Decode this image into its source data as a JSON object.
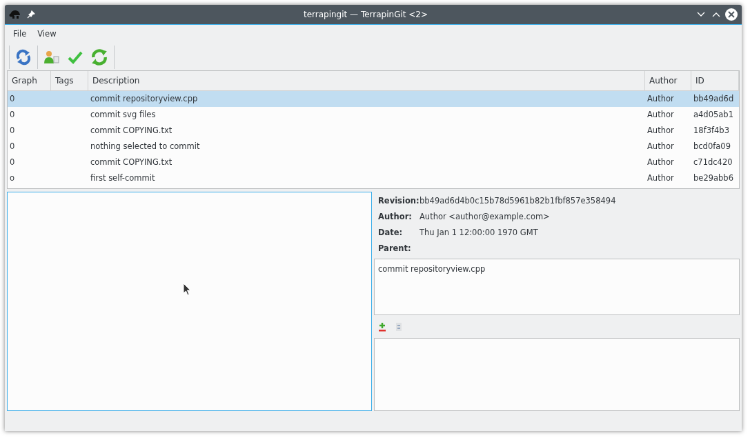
{
  "window": {
    "title": "terrapingit — TerrapinGit <2>"
  },
  "menu": [
    "File",
    "View"
  ],
  "table": {
    "columns": [
      "Graph",
      "Tags",
      "Description",
      "Author",
      "ID"
    ],
    "rows": [
      {
        "graph": "0",
        "tags": "",
        "description": "commit repositoryview.cpp",
        "author": "Author",
        "id": "bb49ad6d",
        "selected": true
      },
      {
        "graph": "0",
        "description": "commit svg files",
        "author": "Author",
        "id": "a4d05ab1",
        "selected": false
      },
      {
        "graph": "0",
        "description": "commit COPYING.txt",
        "author": "Author",
        "id": "18f3f4b3",
        "selected": false
      },
      {
        "graph": "0",
        "description": "nothing selected to commit",
        "author": "Author",
        "id": "bcd0fa09",
        "selected": false
      },
      {
        "graph": "0",
        "description": "commit COPYING.txt",
        "author": "Author",
        "id": "c71dc420",
        "selected": false
      },
      {
        "graph": "o",
        "description": "first self-commit",
        "author": "Author",
        "id": "be29abb6",
        "selected": false
      }
    ]
  },
  "details": [
    {
      "label": "Revision:",
      "value": "bb49ad6d4b0c15b78d5961b82b1fbf857e358494"
    },
    {
      "label": "Author:",
      "value": "Author <author@example.com>"
    },
    {
      "label": "Date:",
      "value": "Thu Jan 1 12:00:00 1970 GMT"
    },
    {
      "label": "Parent:"
    }
  ],
  "message": "commit repositoryview.cpp"
}
